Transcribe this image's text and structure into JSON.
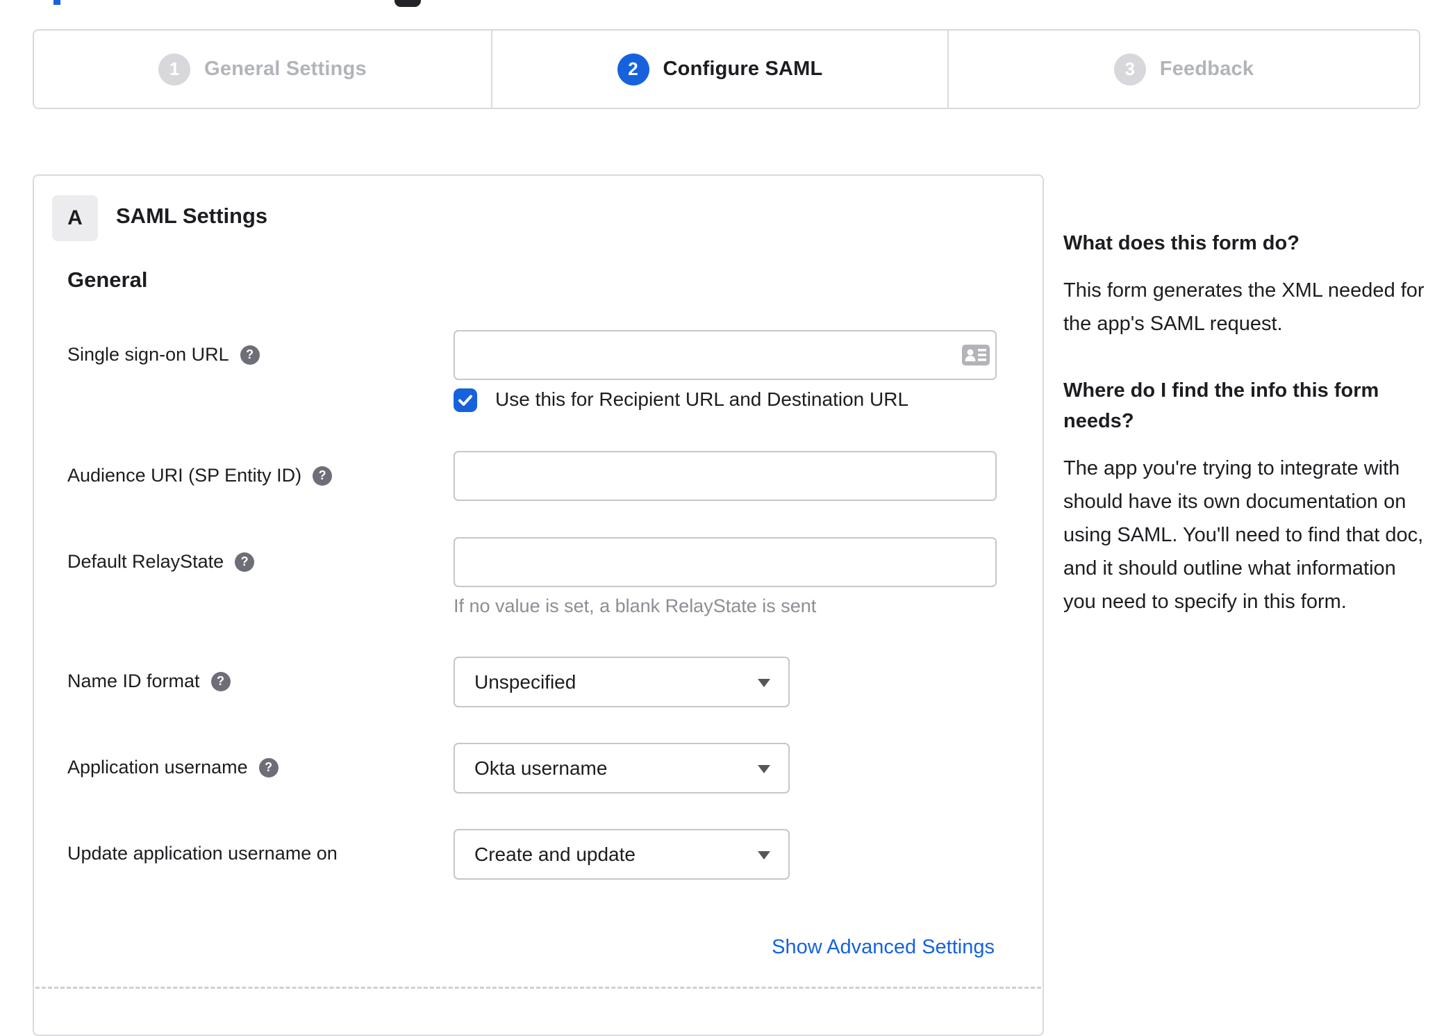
{
  "colors": {
    "accent": "#1662dd",
    "inactive_gray": "#b2b4bb"
  },
  "icons": {
    "help_glyph": "?"
  },
  "stepper": {
    "steps": [
      {
        "number": "1",
        "label": "General Settings",
        "state": "inactive"
      },
      {
        "number": "2",
        "label": "Configure SAML",
        "state": "active"
      },
      {
        "number": "3",
        "label": "Feedback",
        "state": "inactive"
      }
    ]
  },
  "panel": {
    "section_badge": "A",
    "section_title": "SAML Settings",
    "group_heading": "General",
    "fields": {
      "sso_url": {
        "label": "Single sign-on URL",
        "value": "",
        "has_help": true
      },
      "sso_checkbox": {
        "label": "Use this for Recipient URL and Destination URL",
        "checked": true
      },
      "audience_uri": {
        "label": "Audience URI (SP Entity ID)",
        "value": "",
        "has_help": true
      },
      "default_relaystate": {
        "label": "Default RelayState",
        "value": "",
        "helper": "If no value is set, a blank RelayState is sent",
        "has_help": true
      },
      "name_id_format": {
        "label": "Name ID format",
        "value": "Unspecified",
        "has_help": true
      },
      "application_username": {
        "label": "Application username",
        "value": "Okta username",
        "has_help": true
      },
      "update_application_username_on": {
        "label": "Update application username on",
        "value": "Create and update",
        "has_help": false
      }
    },
    "advanced_link": "Show Advanced Settings"
  },
  "sidebar": {
    "sections": [
      {
        "heading": "What does this form do?",
        "body": "This form generates the XML needed for the app's SAML request."
      },
      {
        "heading": "Where do I find the info this form needs?",
        "body": "The app you're trying to integrate with should have its own documentation on using SAML. You'll need to find that doc, and it should outline what information you need to specify in this form."
      }
    ]
  }
}
